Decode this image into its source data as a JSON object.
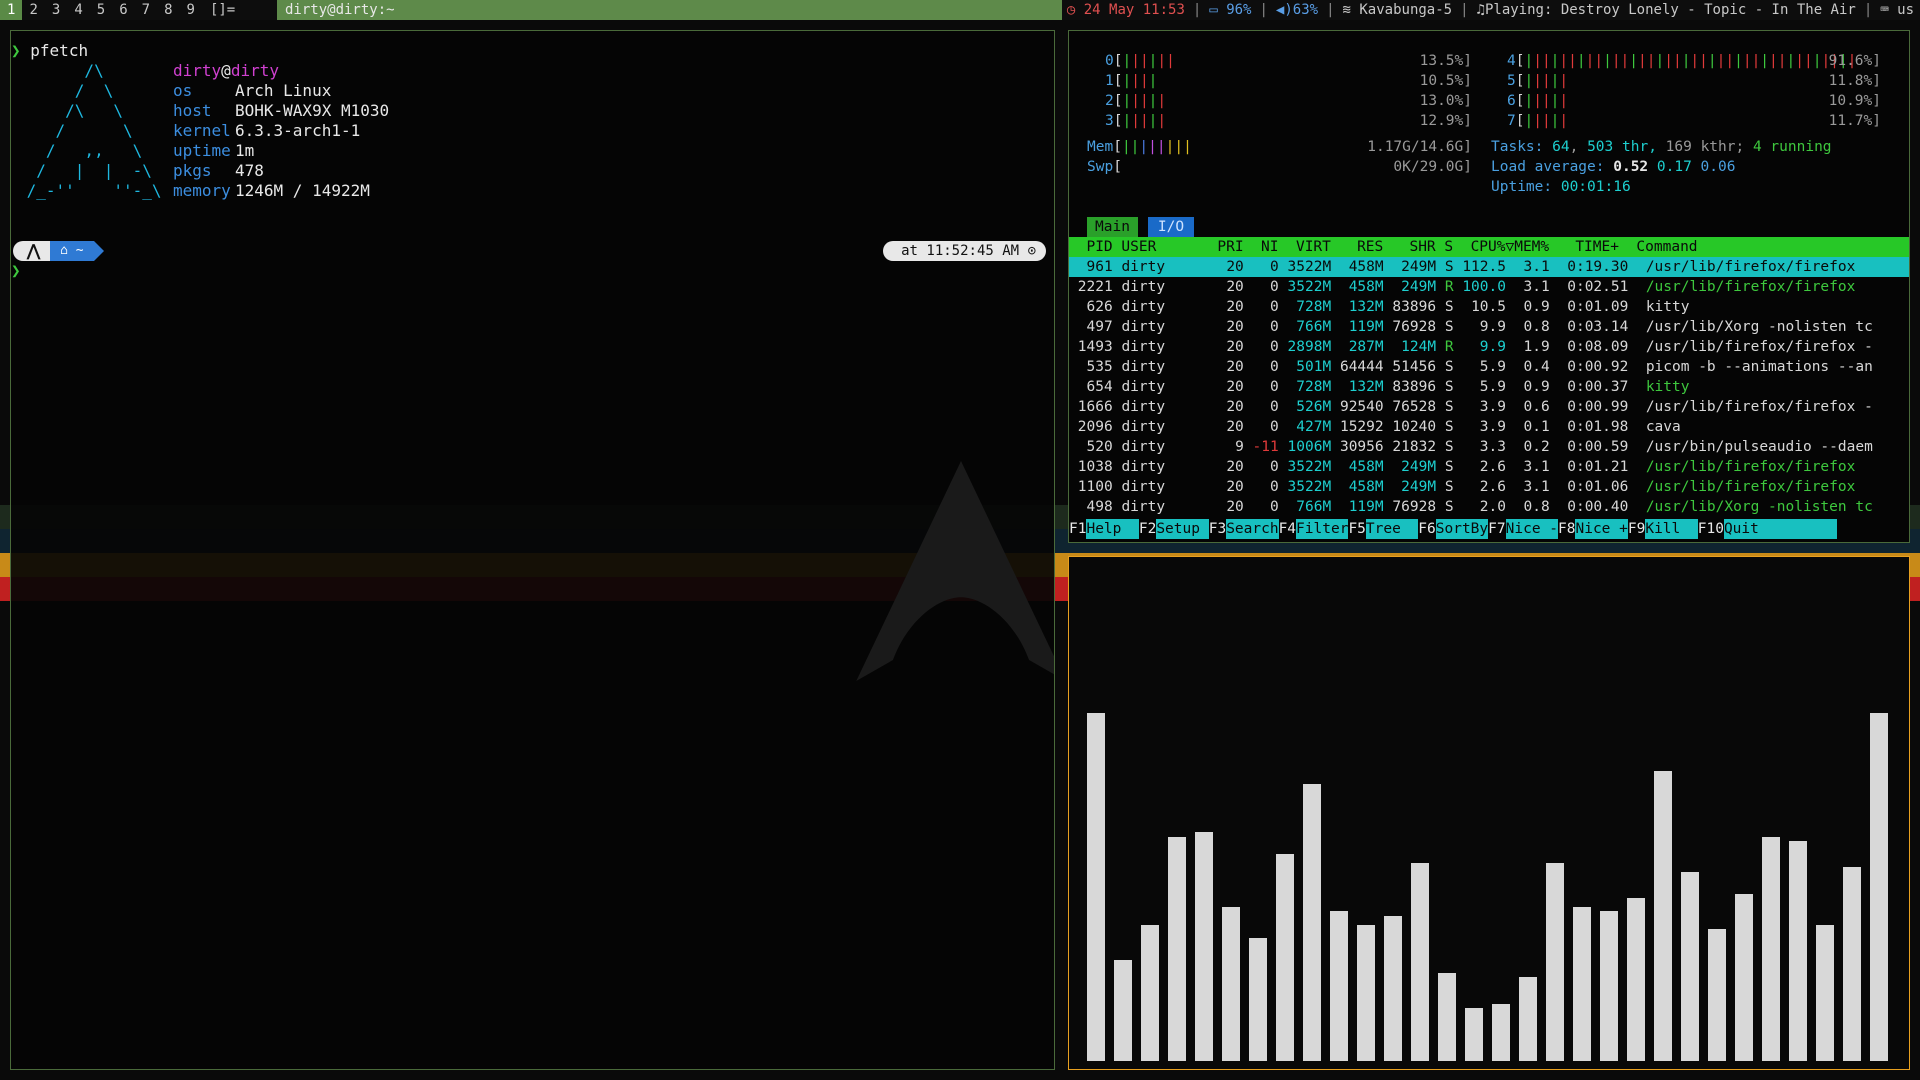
{
  "bar": {
    "workspaces": [
      {
        "label": "1",
        "active": true
      },
      {
        "label": "2",
        "active": false
      },
      {
        "label": "3",
        "active": false
      },
      {
        "label": "4",
        "active": false
      },
      {
        "label": "5",
        "active": false
      },
      {
        "label": "6",
        "active": false
      },
      {
        "label": "7",
        "active": false
      },
      {
        "label": "8",
        "active": false
      },
      {
        "label": "9",
        "active": false
      }
    ],
    "layout": "[]=",
    "window_title": "dirty@dirty:~",
    "status": {
      "date": "24 May 11:53",
      "battery": "96%",
      "volume": "63%",
      "wifi": "Kavabunga-5",
      "music": "Playing: Destroy Lonely - Topic - In The Air",
      "keyboard": "us"
    }
  },
  "terminal": {
    "command": "pfetch",
    "prompt_char": "❯",
    "ascii_logo": [
      "       /\\",
      "      /  \\",
      "     /\\   \\",
      "    /      \\",
      "   /   ,,   \\",
      "  /   |  |  -\\",
      " /_-''    ''-_\\"
    ],
    "user": "dirty",
    "at": "@",
    "hostname": "dirty",
    "info": [
      {
        "key": "os",
        "value": "Arch Linux"
      },
      {
        "key": "host",
        "value": "BOHK-WAX9X M1030"
      },
      {
        "key": "kernel",
        "value": "6.3.3-arch1-1"
      },
      {
        "key": "uptime",
        "value": "1m"
      },
      {
        "key": "pkgs",
        "value": "478"
      },
      {
        "key": "memory",
        "value": "1246M / 14922M"
      }
    ],
    "prompt_home": "~",
    "prompt_time": "at 11:52:45 AM"
  },
  "htop": {
    "cpus_left": [
      {
        "id": "0",
        "pct": "13.5%"
      },
      {
        "id": "1",
        "pct": "10.5%"
      },
      {
        "id": "2",
        "pct": "13.0%"
      },
      {
        "id": "3",
        "pct": "12.9%"
      }
    ],
    "cpus_right": [
      {
        "id": "4",
        "pct": "91.6%"
      },
      {
        "id": "5",
        "pct": "11.8%"
      },
      {
        "id": "6",
        "pct": "10.9%"
      },
      {
        "id": "7",
        "pct": "11.7%"
      }
    ],
    "mem_label": "Mem",
    "mem_value": "1.17G/14.6G",
    "swp_label": "Swp",
    "swp_value": "0K/29.0G",
    "tasks_label": "Tasks:",
    "tasks": "64",
    "thr": "503",
    "thr_label": "thr,",
    "kthr": "169 kthr;",
    "running": "4 running",
    "load_label": "Load average:",
    "load1": "0.52",
    "load5": "0.17",
    "load15": "0.06",
    "uptime_label": "Uptime:",
    "uptime": "00:01:16",
    "tab_main": "Main",
    "tab_io": "I/O",
    "header": "  PID USER       PRI  NI  VIRT   RES   SHR S  CPU%▽MEM%   TIME+  Command",
    "processes": [
      {
        "pid": "961",
        "user": "dirty",
        "pri": "20",
        "ni": "0",
        "virt": "3522M",
        "res": "458M",
        "shr": "249M",
        "s": "S",
        "cpu": "112.5",
        "mem": "3.1",
        "time": "0:19.30",
        "cmd": "/usr/lib/firefox/firefox"
      },
      {
        "pid": "2221",
        "user": "dirty",
        "pri": "20",
        "ni": "0",
        "virt": "3522M",
        "res": "458M",
        "shr": "249M",
        "s": "R",
        "cpu": "100.0",
        "mem": "3.1",
        "time": "0:02.51",
        "cmd": "/usr/lib/firefox/firefox"
      },
      {
        "pid": "626",
        "user": "dirty",
        "pri": "20",
        "ni": "0",
        "virt": "728M",
        "res": "132M",
        "shr": "83896",
        "s": "S",
        "cpu": "10.5",
        "mem": "0.9",
        "time": "0:01.09",
        "cmd": "kitty"
      },
      {
        "pid": "497",
        "user": "dirty",
        "pri": "20",
        "ni": "0",
        "virt": "766M",
        "res": "119M",
        "shr": "76928",
        "s": "S",
        "cpu": "9.9",
        "mem": "0.8",
        "time": "0:03.14",
        "cmd": "/usr/lib/Xorg -nolisten tc"
      },
      {
        "pid": "1493",
        "user": "dirty",
        "pri": "20",
        "ni": "0",
        "virt": "2898M",
        "res": "287M",
        "shr": "124M",
        "s": "R",
        "cpu": "9.9",
        "mem": "1.9",
        "time": "0:08.09",
        "cmd": "/usr/lib/firefox/firefox -"
      },
      {
        "pid": "535",
        "user": "dirty",
        "pri": "20",
        "ni": "0",
        "virt": "501M",
        "res": "64444",
        "shr": "51456",
        "s": "S",
        "cpu": "5.9",
        "mem": "0.4",
        "time": "0:00.92",
        "cmd": "picom -b --animations --an"
      },
      {
        "pid": "654",
        "user": "dirty",
        "pri": "20",
        "ni": "0",
        "virt": "728M",
        "res": "132M",
        "shr": "83896",
        "s": "S",
        "cpu": "5.9",
        "mem": "0.9",
        "time": "0:00.37",
        "cmd": "kitty"
      },
      {
        "pid": "1666",
        "user": "dirty",
        "pri": "20",
        "ni": "0",
        "virt": "526M",
        "res": "92540",
        "shr": "76528",
        "s": "S",
        "cpu": "3.9",
        "mem": "0.6",
        "time": "0:00.99",
        "cmd": "/usr/lib/firefox/firefox -"
      },
      {
        "pid": "2096",
        "user": "dirty",
        "pri": "20",
        "ni": "0",
        "virt": "427M",
        "res": "15292",
        "shr": "10240",
        "s": "S",
        "cpu": "3.9",
        "mem": "0.1",
        "time": "0:01.98",
        "cmd": "cava"
      },
      {
        "pid": "520",
        "user": "dirty",
        "pri": "9",
        "ni": "-11",
        "virt": "1006M",
        "res": "30956",
        "shr": "21832",
        "s": "S",
        "cpu": "3.3",
        "mem": "0.2",
        "time": "0:00.59",
        "cmd": "/usr/bin/pulseaudio --daem"
      },
      {
        "pid": "1038",
        "user": "dirty",
        "pri": "20",
        "ni": "0",
        "virt": "3522M",
        "res": "458M",
        "shr": "249M",
        "s": "S",
        "cpu": "2.6",
        "mem": "3.1",
        "time": "0:01.21",
        "cmd": "/usr/lib/firefox/firefox"
      },
      {
        "pid": "1100",
        "user": "dirty",
        "pri": "20",
        "ni": "0",
        "virt": "3522M",
        "res": "458M",
        "shr": "249M",
        "s": "S",
        "cpu": "2.6",
        "mem": "3.1",
        "time": "0:01.06",
        "cmd": "/usr/lib/firefox/firefox"
      },
      {
        "pid": "498",
        "user": "dirty",
        "pri": "20",
        "ni": "0",
        "virt": "766M",
        "res": "119M",
        "shr": "76928",
        "s": "S",
        "cpu": "2.0",
        "mem": "0.8",
        "time": "0:00.40",
        "cmd": "/usr/lib/Xorg -nolisten tc"
      }
    ],
    "fkeys": [
      {
        "key": "F1",
        "label": "Help  "
      },
      {
        "key": "F2",
        "label": "Setup "
      },
      {
        "key": "F3",
        "label": "Search"
      },
      {
        "key": "F4",
        "label": "Filter"
      },
      {
        "key": "F5",
        "label": "Tree  "
      },
      {
        "key": "F6",
        "label": "SortBy"
      },
      {
        "key": "F7",
        "label": "Nice -"
      },
      {
        "key": "F8",
        "label": "Nice +"
      },
      {
        "key": "F9",
        "label": "Kill  "
      },
      {
        "key": "F10",
        "label": "Quit         "
      }
    ]
  },
  "cava": {
    "levels": [
      0.79,
      0.23,
      0.31,
      0.51,
      0.52,
      0.35,
      0.28,
      0.47,
      0.63,
      0.34,
      0.31,
      0.33,
      0.45,
      0.2,
      0.12,
      0.13,
      0.19,
      0.45,
      0.35,
      0.34,
      0.37,
      0.66,
      0.43,
      0.3,
      0.38,
      0.51,
      0.5,
      0.31,
      0.44,
      0.79
    ],
    "color": "#d8d8d8"
  },
  "colors": {
    "accent_green": "#5e8a4a",
    "htop_cyan": "#18c0c0",
    "cava_border": "#e8a020"
  }
}
